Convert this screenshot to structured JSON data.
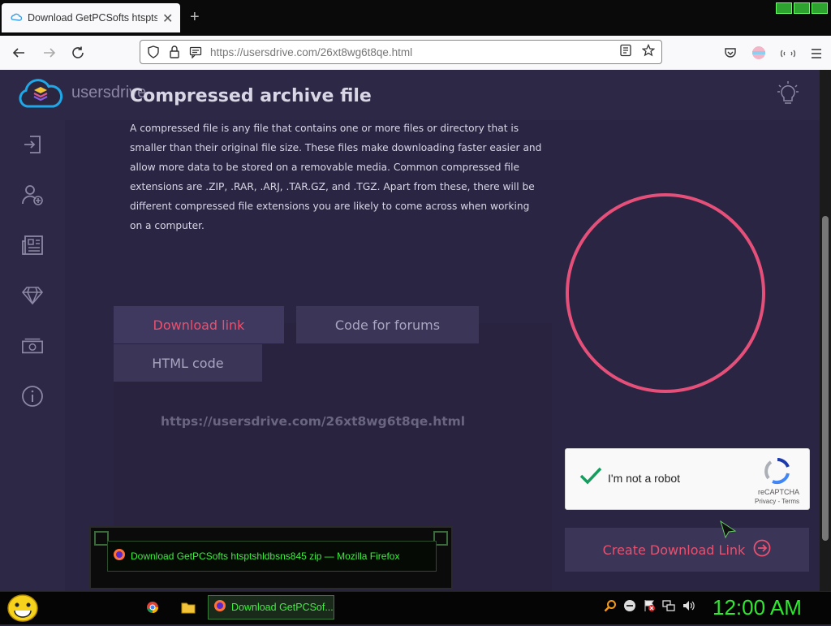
{
  "browser": {
    "tab_title": "Download GetPCSofts htsptshl",
    "tab_close": "✕",
    "new_tab": "+",
    "url_host": "https://usersdrive.com",
    "url_path": "/26xt8wg6t8qe.html"
  },
  "site": {
    "logo_text": "usersdrive",
    "heading": "Compressed archive file",
    "description": "A compressed file is any file that contains one or more files or directory that is smaller than their original file size. These files make downloading faster easier and allow more data to be stored on a removable media. Common compressed file extensions are .ZIP, .RAR, .ARJ, .TAR.GZ, and .TGZ. Apart from these, there will be different compressed file extensions you are likely to come across when working on a computer.",
    "tabs": {
      "download_link": "Download link",
      "code_for_forums": "Code for forums",
      "html_code": "HTML code"
    },
    "link_value": "https://usersdrive.com/26xt8wg6t8qe.html",
    "create_button": "Create Download Link",
    "accent_color": "#e8516f"
  },
  "captcha": {
    "label": "I'm not a robot",
    "brand": "reCAPTCHA",
    "links": "Privacy - Terms"
  },
  "taskbar": {
    "task_label": "Download GetPCSof...",
    "tooltip": "Download GetPCSofts htsptshldbsns845 zip — Mozilla Firefox",
    "clock": "12:00 AM"
  }
}
